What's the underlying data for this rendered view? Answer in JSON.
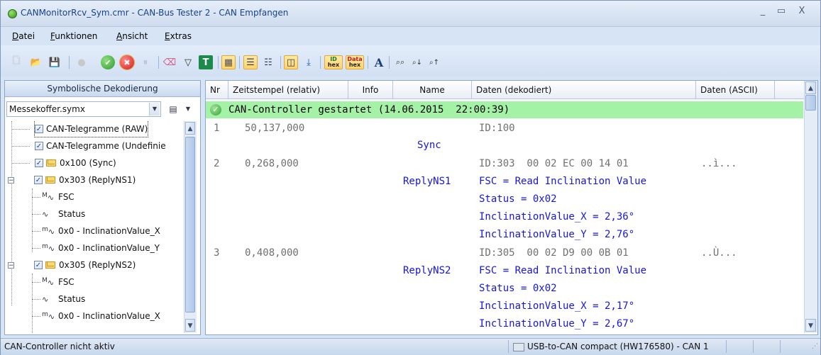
{
  "window": {
    "title": "CANMonitorRcv_Sym.cmr - CAN-Bus Tester 2 - CAN Empfangen",
    "buttons": {
      "minimize": "_",
      "maximize": "▭",
      "close": "X"
    }
  },
  "menu": [
    {
      "label": "Datei",
      "accel": "D",
      "rest": "atei"
    },
    {
      "label": "Funktionen",
      "accel": "F",
      "rest": "unktionen"
    },
    {
      "label": "Ansicht",
      "accel": "A",
      "rest": "nsicht"
    },
    {
      "label": "Extras",
      "accel": "E",
      "rest": "xtras"
    }
  ],
  "toolbar": {
    "icons": [
      {
        "name": "new-file-icon",
        "glyph": "🗋",
        "active": false
      },
      {
        "name": "open-folder-icon",
        "glyph": "📂",
        "active": false
      },
      {
        "name": "save-icon",
        "glyph": "💾",
        "active": false
      },
      {
        "name": "record-disabled-icon",
        "glyph": "●",
        "active": false
      },
      {
        "name": "start-icon",
        "glyph": "✔",
        "active": false
      },
      {
        "name": "stop-icon",
        "glyph": "✖",
        "active": false
      },
      {
        "name": "pause-disabled-icon",
        "glyph": "⏸",
        "active": false
      },
      {
        "name": "clear-icon",
        "glyph": "⌫",
        "active": false
      },
      {
        "name": "filter-icon",
        "glyph": "▼",
        "active": false
      },
      {
        "name": "trigger-icon",
        "glyph": "T",
        "active": false
      },
      {
        "name": "grid-view-icon",
        "glyph": "▦",
        "active": true
      },
      {
        "name": "list-view-icon",
        "glyph": "☰",
        "active": true
      },
      {
        "name": "list-view2-icon",
        "glyph": "☷",
        "active": false
      },
      {
        "name": "symbolic-view-icon",
        "glyph": "◫",
        "active": true
      },
      {
        "name": "autoscroll-icon",
        "glyph": "⤓",
        "active": false
      },
      {
        "name": "id-hex-icon",
        "glyph": "ID",
        "active": true
      },
      {
        "name": "data-hex-icon",
        "glyph": "Da",
        "active": true
      },
      {
        "name": "font-icon",
        "glyph": "A",
        "active": false
      },
      {
        "name": "find-icon",
        "glyph": "🔍",
        "active": false
      },
      {
        "name": "find-next-icon",
        "glyph": "⇣",
        "active": false
      },
      {
        "name": "find-prev-icon",
        "glyph": "⇡",
        "active": false
      }
    ]
  },
  "left_panel": {
    "header": "Symbolische Dekodierung",
    "combo": {
      "value": "Messekoffer.symx"
    },
    "tree": [
      {
        "label": "CAN-Telegramme (RAW)",
        "checkbox": true,
        "kind": "raw"
      },
      {
        "label": "CAN-Telegramme (Undefinie",
        "checkbox": true,
        "kind": "raw"
      },
      {
        "label": "0x100 (Sync)",
        "checkbox": true,
        "kind": "message"
      },
      {
        "label": "0x303 (ReplyNS1)",
        "checkbox": true,
        "kind": "message",
        "expanded": true
      },
      {
        "label": "FSC",
        "kind": "multiplexer",
        "badge": "M"
      },
      {
        "label": "Status",
        "kind": "signal"
      },
      {
        "label": "0x0 - InclinationValue_X",
        "kind": "mux-signal",
        "badge": "m"
      },
      {
        "label": "0x0 - InclinationValue_Y",
        "kind": "mux-signal",
        "badge": "m"
      },
      {
        "label": "0x305 (ReplyNS2)",
        "checkbox": true,
        "kind": "message",
        "expanded": true
      },
      {
        "label": "FSC",
        "kind": "multiplexer",
        "badge": "M"
      },
      {
        "label": "Status",
        "kind": "signal"
      },
      {
        "label": "0x0 - InclinationValue_X",
        "kind": "mux-signal",
        "badge": "m"
      }
    ]
  },
  "grid": {
    "columns": [
      "Nr",
      "Zeitstempel (relativ)",
      "Info",
      "Name",
      "Daten (dekodiert)",
      "Daten (ASCII)"
    ],
    "banner": "CAN-Controller gestartet (14.06.2015  22:00:39)",
    "rows": [
      {
        "nr": "1",
        "time": "50,137,000",
        "name": "",
        "data": "ID:100",
        "ascii": ""
      },
      {
        "nr": "",
        "time": "",
        "name": "Sync",
        "data": "",
        "ascii": ""
      },
      {
        "nr": "2",
        "time": "0,268,000",
        "name": "",
        "data": "ID:303  00 02 EC 00 14 01",
        "ascii": "..ì..."
      },
      {
        "nr": "",
        "time": "",
        "name": "ReplyNS1",
        "data": "FSC = Read Inclination Value",
        "ascii": ""
      },
      {
        "nr": "",
        "time": "",
        "name": "",
        "data": "Status = 0x02",
        "ascii": ""
      },
      {
        "nr": "",
        "time": "",
        "name": "",
        "data": "InclinationValue_X = 2,36°",
        "ascii": ""
      },
      {
        "nr": "",
        "time": "",
        "name": "",
        "data": "InclinationValue_Y = 2,76°",
        "ascii": ""
      },
      {
        "nr": "3",
        "time": "0,408,000",
        "name": "",
        "data": "ID:305  00 02 D9 00 0B 01",
        "ascii": "..Ù..."
      },
      {
        "nr": "",
        "time": "",
        "name": "ReplyNS2",
        "data": "FSC = Read Inclination Value",
        "ascii": ""
      },
      {
        "nr": "",
        "time": "",
        "name": "",
        "data": "Status = 0x02",
        "ascii": ""
      },
      {
        "nr": "",
        "time": "",
        "name": "",
        "data": "InclinationValue_X = 2,17°",
        "ascii": ""
      },
      {
        "nr": "",
        "time": "",
        "name": "",
        "data": "InclinationValue_Y = 2,67°",
        "ascii": ""
      }
    ]
  },
  "statusbar": {
    "left": "CAN-Controller nicht aktiv",
    "device": "USB-to-CAN compact (HW176580) - CAN 1"
  },
  "colors": {
    "banner_bg": "#a4f2a6",
    "signal_text": "#1515e0",
    "raw_text": "#707070",
    "titlebar_text": "#15428b"
  }
}
